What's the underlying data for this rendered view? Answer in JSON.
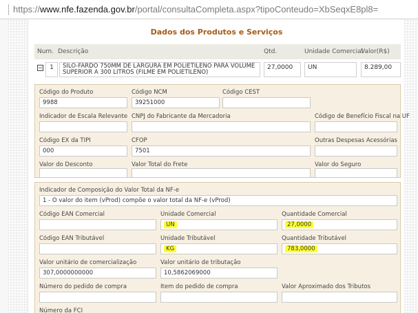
{
  "browser": {
    "url_scheme": "https://",
    "url_host": "www.nfe.fazenda.gov.br",
    "url_path": "/portal/consultaCompleta.aspx?tipoConteudo=XbSeqxE8pl8="
  },
  "section": {
    "title": "Dados dos Produtos e Serviços"
  },
  "table": {
    "headers": {
      "num": "Num.",
      "descricao": "Descrição",
      "qtd": "Qtd.",
      "unidade": "Unidade Comercial",
      "valor": "Valor(R$)"
    },
    "item": {
      "toggle": "−",
      "num": "1",
      "descricao": "SILO-FARDO 750MM DE LARGURA EM POLIETILENO PARA VOLUME SUPERIOR A 300 LITROS (FILME EM POLIETILENO)",
      "qtd": "27,0000",
      "unidade": "UN",
      "valor": "8.289,00"
    }
  },
  "detail": {
    "codigo_produto": {
      "label": "Código do Produto",
      "value": "9988"
    },
    "codigo_ncm": {
      "label": "Código NCM",
      "value": "39251000"
    },
    "codigo_cest": {
      "label": "Código CEST",
      "value": ""
    },
    "indicador_escala": {
      "label": "Indicador de Escala Relevante",
      "value": ""
    },
    "cnpj_fabricante": {
      "label": "CNPJ do Fabricante da Mercadoria",
      "value": ""
    },
    "codigo_beneficio": {
      "label": "Código de Benefício Fiscal na UF",
      "value": ""
    },
    "codigo_ex_tipi": {
      "label": "Código EX da TIPI",
      "value": "000"
    },
    "cfop": {
      "label": "CFOP",
      "value": "7501"
    },
    "outras_despesas": {
      "label": "Outras Despesas Acessórias",
      "value": ""
    },
    "valor_desconto": {
      "label": "Valor do Desconto",
      "value": ""
    },
    "valor_frete": {
      "label": "Valor Total do Frete",
      "value": ""
    },
    "valor_seguro": {
      "label": "Valor do Seguro",
      "value": ""
    }
  },
  "composicao": {
    "label": "Indicador de Composição do Valor Total da NF-e",
    "value": "1 - O valor do item (vProd) compõe o valor total da NF-e (vProd)",
    "ean_comercial": {
      "label": "Código EAN Comercial",
      "value": ""
    },
    "unidade_comercial": {
      "label": "Unidade Comercial",
      "value": "UN"
    },
    "quantidade_comercial": {
      "label": "Quantidade Comercial",
      "value": "27,0000"
    },
    "ean_tributavel": {
      "label": "Código EAN Tributável",
      "value": ""
    },
    "unidade_tributavel": {
      "label": "Unidade Tributável",
      "value": "KG"
    },
    "quantidade_tributavel": {
      "label": "Quantidade Tributável",
      "value": "783,0000"
    },
    "valor_unit_comercializacao": {
      "label": "Valor unitário de comercialização",
      "value": "307,0000000000"
    },
    "valor_unit_tributacao": {
      "label": "Valor unitário de tributação",
      "value": "10,5862069000"
    },
    "numero_pedido": {
      "label": "Número do pedido de compra",
      "value": ""
    },
    "item_pedido": {
      "label": "Item do pedido de compra",
      "value": ""
    },
    "valor_aprox_tributos": {
      "label": "Valor Aproximado dos Tributos",
      "value": ""
    },
    "numero_fci": {
      "label": "Número da FCI"
    }
  },
  "colors": {
    "title": "#a65b16",
    "panel_bg": "#f7f0e2",
    "highlight": "#ffff33"
  }
}
